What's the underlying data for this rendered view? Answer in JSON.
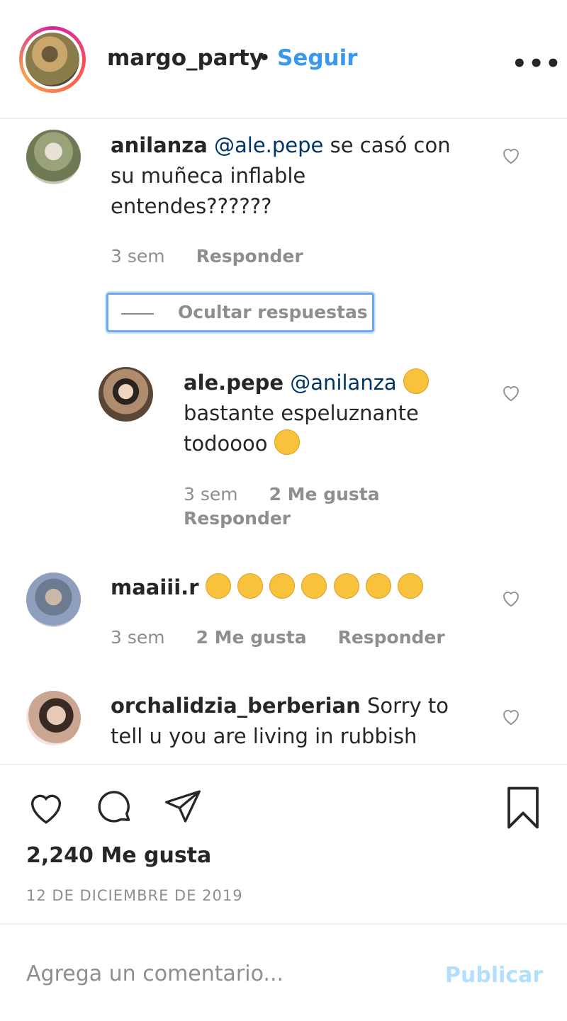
{
  "header": {
    "username": "margo_party",
    "separator": "•",
    "follow_label": "Seguir",
    "more_label": "•••"
  },
  "comments": [
    {
      "user": "anilanza",
      "mention": "@ale.pepe",
      "text_line1": " se casó con",
      "text_line2": "su muñeca inflable",
      "text_line3": "entendes??????",
      "time": "3 sem",
      "reply_label": "Responder"
    },
    {
      "user": "maaiii.r",
      "emoji_count": 7,
      "time": "3 sem",
      "likes": "2 Me gusta",
      "reply_label": "Responder"
    },
    {
      "user": "orchalidzia_berberian",
      "text_line1": " Sorry to",
      "text_line2": "tell u you are living in rubbish"
    }
  ],
  "hide_replies_label": "Ocultar respuestas",
  "reply": {
    "user": "ale.pepe",
    "mention": "@anilanza",
    "text_line2": "bastante espeluznante",
    "text_line3": "todoooo",
    "time": "3 sem",
    "likes": "2 Me gusta",
    "reply_label": "Responder"
  },
  "likes_count": "2,240 Me gusta",
  "date": "12 DE DICIEMBRE DE 2019",
  "add_comment": {
    "placeholder": "Agrega un comentario...",
    "publish_label": "Publicar"
  },
  "colors": {
    "accent": "#3897f0",
    "muted": "#8e8e8e",
    "text": "#262626",
    "publish_disabled": "#b2dffc"
  }
}
